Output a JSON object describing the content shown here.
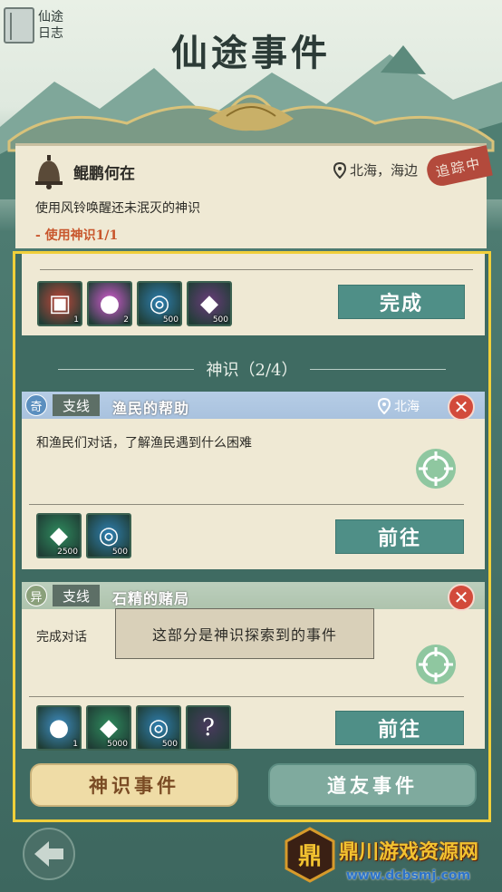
{
  "header": {
    "diary_label_line1": "仙途",
    "diary_label_line2": "日志",
    "title": "仙途事件"
  },
  "tracked_quest": {
    "title": "鲲鹏何在",
    "location": "北海，海边",
    "status_badge": "追踪中",
    "description": "使用风铃唤醒还未泯灭的神识",
    "progress": "- 使用神识1/1",
    "rewards": [
      {
        "icon": "red-book-icon",
        "count": "1",
        "color": "#c4473a"
      },
      {
        "icon": "pink-orb-icon",
        "count": "2",
        "color": "#d45ad0"
      },
      {
        "icon": "blue-swirl-icon",
        "count": "500",
        "color": "#2f7fb0"
      },
      {
        "icon": "purple-gem-icon",
        "count": "500",
        "color": "#6a3c7a"
      }
    ],
    "complete_label": "完成"
  },
  "section": {
    "title": "神识（2/4）"
  },
  "events": [
    {
      "type_char": "奇",
      "tag": "支线",
      "title": "渔民的帮助",
      "location": "北海",
      "description": "和渔民们对话，了解渔民遇到什么困难",
      "rewards": [
        {
          "icon": "green-crystal-icon",
          "count": "2500",
          "color": "#2f8b5e"
        },
        {
          "icon": "blue-swirl-icon",
          "count": "500",
          "color": "#2f7fb0"
        }
      ],
      "go_label": "前往"
    },
    {
      "type_char": "异",
      "tag": "支线",
      "title": "石精的赌局",
      "description": "完成对话",
      "rewards": [
        {
          "icon": "blue-orb-icon",
          "count": "1",
          "color": "#3f8ec4"
        },
        {
          "icon": "green-crystal-icon",
          "count": "5000",
          "color": "#2f8b5e"
        },
        {
          "icon": "blue-swirl-icon",
          "count": "500",
          "color": "#2f7fb0"
        },
        {
          "icon": "mystery-question-icon",
          "count": "",
          "color": "#4a3a5e"
        }
      ],
      "go_label": "前往"
    }
  ],
  "tooltip": "这部分是神识探索到的事件",
  "tabs": {
    "left": "神识事件",
    "right": "道友事件"
  },
  "watermark": {
    "name": "鼎川游戏资源网",
    "url": "www.dcbsmj.com",
    "logo_char": "鼎"
  }
}
